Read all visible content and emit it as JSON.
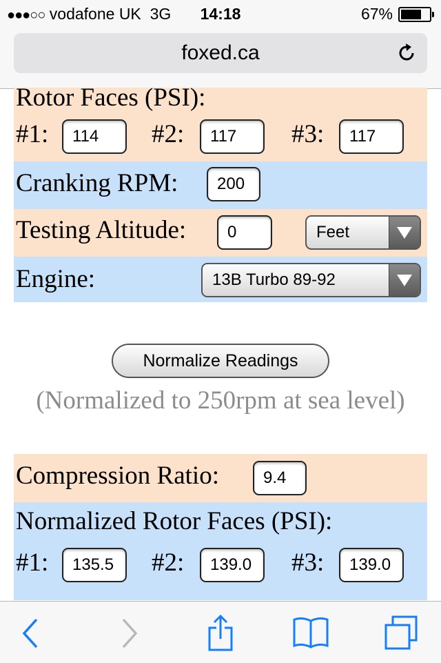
{
  "status_bar": {
    "signal_dots": "●●●○○",
    "carrier": "vodafone UK",
    "network": "3G",
    "time": "14:18",
    "battery": "67%",
    "battery_level": 0.67
  },
  "browser": {
    "url": "foxed.ca",
    "reload_icon": "reload-icon"
  },
  "form": {
    "rotor_faces_label": "Rotor Faces (PSI):",
    "rotor_inputs": [
      {
        "label": "#1:",
        "value": "114"
      },
      {
        "label": "#2:",
        "value": "117"
      },
      {
        "label": "#3:",
        "value": "117"
      }
    ],
    "cranking_label": "Cranking RPM:",
    "cranking_value": "200",
    "altitude_label": "Testing Altitude:",
    "altitude_value": "0",
    "altitude_unit": "Feet",
    "engine_label": "Engine:",
    "engine_value": "13B Turbo 89-92",
    "normalize_button": "Normalize Readings",
    "normalize_note": "(Normalized to 250rpm at sea level)",
    "compression_label": "Compression Ratio:",
    "compression_value": "9.4",
    "normalized_label": "Normalized Rotor Faces (PSI):",
    "normalized_inputs": [
      {
        "label": "#1:",
        "value": "135.5"
      },
      {
        "label": "#2:",
        "value": "139.0"
      },
      {
        "label": "#3:",
        "value": "139.0"
      }
    ]
  },
  "toolbar": {
    "icons": [
      "back-icon",
      "forward-icon",
      "share-icon",
      "bookmarks-icon",
      "tabs-icon"
    ]
  },
  "colors": {
    "peach": "#fce1cb",
    "blue": "#c8e1fb",
    "ios_blue": "#147efb"
  }
}
